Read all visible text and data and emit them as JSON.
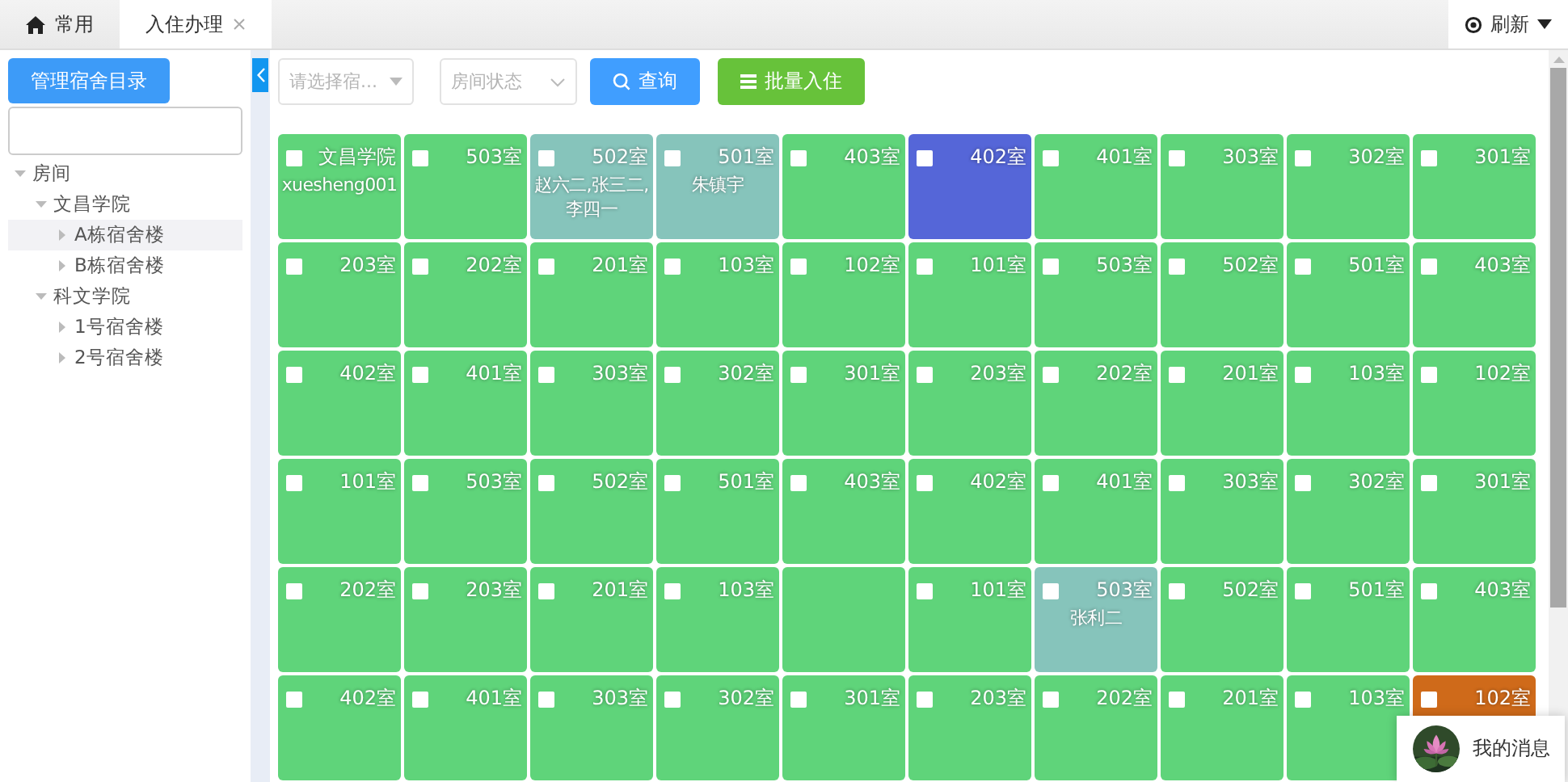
{
  "tabs": [
    {
      "label": "常用",
      "closable": false,
      "selected": false
    },
    {
      "label": "入住办理",
      "closable": true,
      "selected": true
    }
  ],
  "refresh": {
    "label": "刷新"
  },
  "sidebar": {
    "button": "管理宿舍目录",
    "tree": [
      {
        "label": "房间",
        "expanded": true,
        "selected": false,
        "children": [
          {
            "label": "文昌学院",
            "expanded": true,
            "selected": false,
            "children": [
              {
                "label": "A栋宿舍楼",
                "expanded": false,
                "selected": true
              },
              {
                "label": "B栋宿舍楼",
                "expanded": false,
                "selected": false
              }
            ]
          },
          {
            "label": "科文学院",
            "expanded": true,
            "selected": false,
            "children": [
              {
                "label": "1号宿舍楼",
                "expanded": false,
                "selected": false
              },
              {
                "label": "2号宿舍楼",
                "expanded": false,
                "selected": false
              }
            ]
          }
        ]
      }
    ]
  },
  "filters": [
    {
      "placeholder": "请选择宿...",
      "kind": "caret"
    },
    {
      "placeholder": "房间状态",
      "kind": "chevron"
    }
  ],
  "buttons": [
    {
      "label": "查询",
      "kind": "search"
    },
    {
      "label": "批量入住",
      "kind": "batch"
    }
  ],
  "rooms": [
    [
      {
        "name": "文昌学院",
        "occupants": "xuesheng001",
        "kind": "vacant",
        "checked": false
      },
      {
        "name": "503室",
        "kind": "vacant",
        "checked": false
      },
      {
        "name": "502室",
        "occupants": "赵六二,张三二,李四一",
        "kind": "partial",
        "checked": false
      },
      {
        "name": "501室",
        "occupants": "朱镇宇",
        "kind": "partial",
        "checked": false
      },
      {
        "name": "403室",
        "kind": "vacant",
        "checked": false
      },
      {
        "name": "402室",
        "kind": "current",
        "checked": false
      },
      {
        "name": "401室",
        "kind": "vacant",
        "checked": false
      },
      {
        "name": "303室",
        "kind": "vacant",
        "checked": false
      },
      {
        "name": "302室",
        "kind": "vacant",
        "checked": false
      },
      {
        "name": "301室",
        "kind": "vacant",
        "checked": false
      }
    ],
    [
      {
        "name": "203室",
        "kind": "vacant",
        "checked": false
      },
      {
        "name": "202室",
        "kind": "vacant",
        "checked": false
      },
      {
        "name": "201室",
        "kind": "vacant",
        "checked": false
      },
      {
        "name": "103室",
        "kind": "vacant",
        "checked": false
      },
      {
        "name": "102室",
        "kind": "vacant",
        "checked": false
      },
      {
        "name": "101室",
        "kind": "vacant",
        "checked": false
      },
      {
        "name": "503室",
        "kind": "vacant",
        "checked": false
      },
      {
        "name": "502室",
        "kind": "vacant",
        "checked": false
      },
      {
        "name": "501室",
        "kind": "vacant",
        "checked": false
      },
      {
        "name": "403室",
        "kind": "vacant",
        "checked": false
      }
    ],
    [
      {
        "name": "402室",
        "kind": "vacant",
        "checked": false
      },
      {
        "name": "401室",
        "kind": "vacant",
        "checked": false
      },
      {
        "name": "303室",
        "kind": "vacant",
        "checked": false
      },
      {
        "name": "302室",
        "kind": "vacant",
        "checked": false
      },
      {
        "name": "301室",
        "kind": "vacant",
        "checked": false
      },
      {
        "name": "203室",
        "kind": "vacant",
        "checked": false
      },
      {
        "name": "202室",
        "kind": "vacant",
        "checked": false
      },
      {
        "name": "201室",
        "kind": "vacant",
        "checked": false
      },
      {
        "name": "103室",
        "kind": "vacant",
        "checked": false
      },
      {
        "name": "102室",
        "kind": "vacant",
        "checked": false
      }
    ],
    [
      {
        "name": "101室",
        "kind": "vacant",
        "checked": false
      },
      {
        "name": "503室",
        "kind": "vacant",
        "checked": false
      },
      {
        "name": "502室",
        "kind": "vacant",
        "checked": false
      },
      {
        "name": "501室",
        "kind": "vacant",
        "checked": false
      },
      {
        "name": "403室",
        "kind": "vacant",
        "checked": false
      },
      {
        "name": "402室",
        "kind": "vacant",
        "checked": false
      },
      {
        "name": "401室",
        "kind": "vacant",
        "checked": false
      },
      {
        "name": "303室",
        "kind": "vacant",
        "checked": false
      },
      {
        "name": "302室",
        "kind": "vacant",
        "checked": false
      },
      {
        "name": "301室",
        "kind": "vacant",
        "checked": false
      }
    ],
    [
      {
        "name": "202室",
        "kind": "vacant",
        "checked": false
      },
      {
        "name": "203室",
        "kind": "vacant",
        "checked": false
      },
      {
        "name": "201室",
        "kind": "vacant",
        "checked": false
      },
      {
        "name": "103室",
        "kind": "vacant",
        "checked": false
      },
      {
        "kind": "vacant"
      },
      {
        "name": "101室",
        "kind": "vacant",
        "checked": false
      },
      {
        "name": "503室",
        "occupants": "张利二",
        "kind": "partial",
        "checked": false
      },
      {
        "name": "502室",
        "kind": "vacant",
        "checked": false
      },
      {
        "name": "501室",
        "kind": "vacant",
        "checked": false
      },
      {
        "name": "403室",
        "kind": "vacant",
        "checked": false
      }
    ],
    [
      {
        "name": "402室",
        "kind": "vacant",
        "checked": false
      },
      {
        "name": "401室",
        "kind": "vacant",
        "checked": false
      },
      {
        "name": "303室",
        "kind": "vacant",
        "checked": false
      },
      {
        "name": "302室",
        "kind": "vacant",
        "checked": false
      },
      {
        "name": "301室",
        "kind": "vacant",
        "checked": false
      },
      {
        "name": "203室",
        "kind": "vacant",
        "checked": false
      },
      {
        "name": "202室",
        "kind": "vacant",
        "checked": false
      },
      {
        "name": "201室",
        "kind": "vacant",
        "checked": false
      },
      {
        "name": "103室",
        "kind": "vacant",
        "checked": false
      },
      {
        "name": "102室",
        "kind": "full",
        "checked": false
      }
    ]
  ],
  "message_popup": {
    "label": "我的消息"
  }
}
